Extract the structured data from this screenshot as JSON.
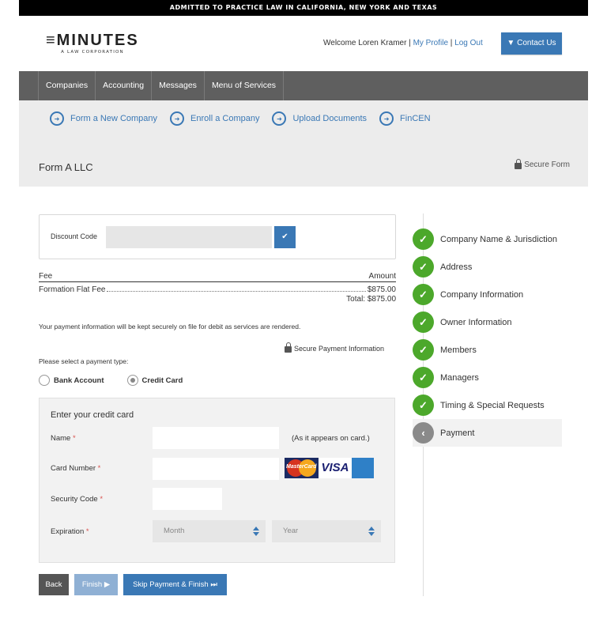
{
  "topbar": {
    "text": "ADMITTED TO PRACTICE LAW IN CALIFORNIA, NEW YORK AND TEXAS"
  },
  "logo": {
    "name": "≡MINUTES",
    "tagline": "A LAW CORPORATION"
  },
  "header": {
    "welcome": "Welcome Loren Kramer",
    "sep1": " | ",
    "my_profile": "My Profile",
    "sep2": " | ",
    "log_out": "Log Out",
    "contact_us": "▼ Contact Us"
  },
  "main_nav": [
    {
      "label": "Companies"
    },
    {
      "label": "Accounting"
    },
    {
      "label": "Messages"
    },
    {
      "label": "Menu of Services"
    }
  ],
  "sub_nav": [
    {
      "label": "Form a New Company",
      "icon": "arrow-circle-right-icon"
    },
    {
      "label": "Enroll a Company",
      "icon": "arrow-circle-right-icon"
    },
    {
      "label": "Upload Documents",
      "icon": "arrow-circle-right-icon"
    },
    {
      "label": "FinCEN",
      "icon": "arrow-circle-right-icon"
    }
  ],
  "page": {
    "title": "Form A LLC",
    "secure_form": "Secure Form"
  },
  "discount": {
    "label": "Discount Code",
    "value": "",
    "apply_icon": "✔"
  },
  "fees": {
    "col_fee": "Fee",
    "col_amount": "Amount",
    "rows": [
      {
        "fee": "Formation Flat Fee",
        "amount": "$875.00"
      }
    ],
    "total": "Total: $875.00"
  },
  "payment": {
    "note": "Your payment information will be kept securely on file for debit as services are rendered.",
    "secure_info": "Secure Payment Information",
    "select_prompt": "Please select a payment type:",
    "types": [
      {
        "label": "Bank Account",
        "selected": false
      },
      {
        "label": "Credit Card",
        "selected": true
      }
    ]
  },
  "credit_card": {
    "title": "Enter your credit card",
    "name_label": "Name",
    "name_value": "",
    "name_hint": "(As it appears on card.)",
    "number_label": "Card Number",
    "number_value": "",
    "security_label": "Security Code",
    "security_value": "",
    "expiration_label": "Expiration",
    "month_placeholder": "Month",
    "year_placeholder": "Year",
    "required_mark": "*",
    "card_brands": [
      "MasterCard",
      "VISA",
      "American Express"
    ]
  },
  "actions": {
    "back": "Back",
    "finish": "Finish ▶",
    "skip": "Skip Payment & Finish ⏭"
  },
  "steps": [
    {
      "label": "Company Name & Jurisdiction",
      "status": "complete",
      "icon": "✓"
    },
    {
      "label": "Address",
      "status": "complete",
      "icon": "✓"
    },
    {
      "label": "Company Information",
      "status": "complete",
      "icon": "✓"
    },
    {
      "label": "Owner Information",
      "status": "complete",
      "icon": "✓"
    },
    {
      "label": "Members",
      "status": "complete",
      "icon": "✓"
    },
    {
      "label": "Managers",
      "status": "complete",
      "icon": "✓"
    },
    {
      "label": "Timing & Special Requests",
      "status": "complete",
      "icon": "✓"
    },
    {
      "label": "Payment",
      "status": "current",
      "icon": "‹"
    }
  ],
  "colors": {
    "brand_blue": "#3a78b5",
    "success_green": "#4ca82b",
    "nav_gray": "#5f5f5f",
    "required_red": "#d9534f"
  }
}
